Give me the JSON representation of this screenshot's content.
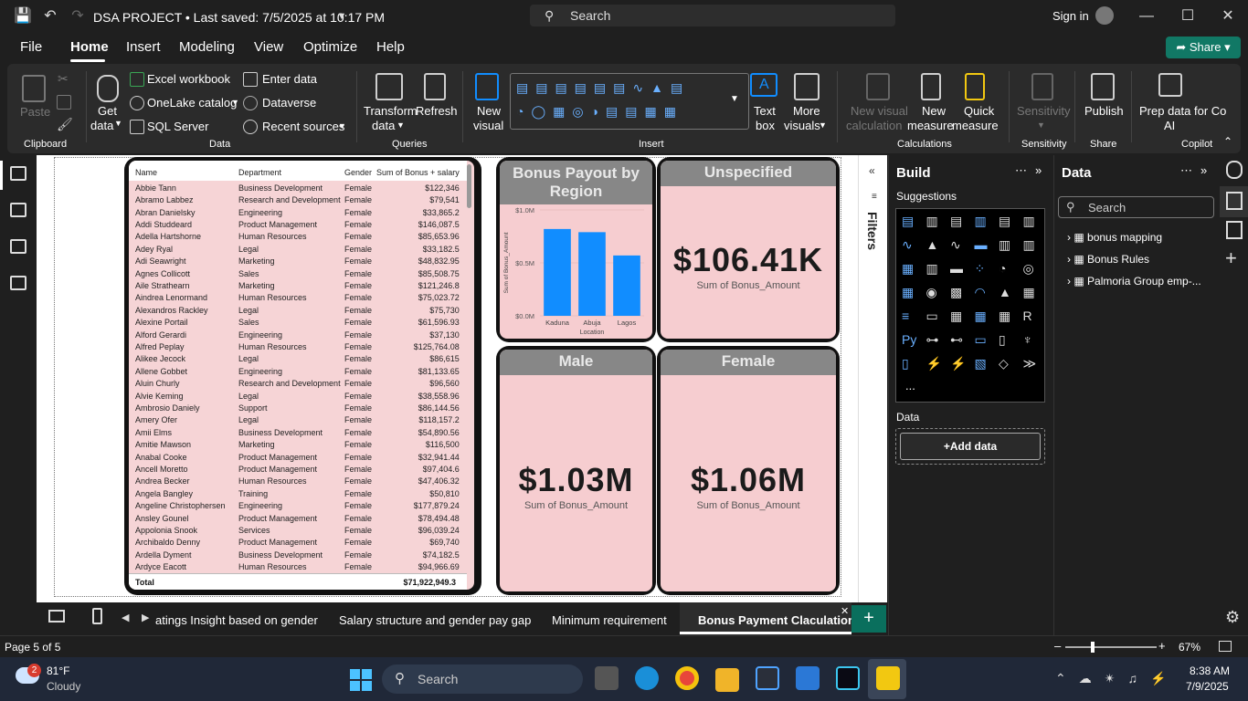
{
  "window": {
    "title": "DSA PROJECT • Last saved: 7/5/2025 at 10:17 PM",
    "search_placeholder": "Search",
    "sign_in": "Sign in"
  },
  "menu": [
    "File",
    "Home",
    "Insert",
    "Modeling",
    "View",
    "Optimize",
    "Help"
  ],
  "share_label": "Share",
  "ribbon": {
    "paste": "Paste",
    "clipboard": "Clipboard",
    "get_data_1": "Get",
    "get_data_2": "data",
    "excel_workbook": "Excel workbook",
    "onelake_catalog": "OneLake catalog",
    "sql_server": "SQL Server",
    "enter_data": "Enter data",
    "dataverse": "Dataverse",
    "recent_sources": "Recent sources",
    "data_group": "Data",
    "transform_1": "Transform",
    "transform_2": "data",
    "refresh": "Refresh",
    "queries_group": "Queries",
    "new_visual_1": "New",
    "new_visual_2": "visual",
    "insert_group": "Insert",
    "text_box_1": "Text",
    "text_box_2": "box",
    "more_visuals_1": "More",
    "more_visuals_2": "visuals",
    "new_visual_calc_1": "New visual",
    "new_visual_calc_2": "calculation",
    "new_measure_1": "New",
    "new_measure_2": "measure",
    "quick_measure_1": "Quick",
    "quick_measure_2": "measure",
    "calculations_group": "Calculations",
    "sensitivity": "Sensitivity",
    "sensitivity_group": "Sensitivity",
    "publish": "Publish",
    "share_group": "Share",
    "prep_ai_1": "Prep data for Co",
    "prep_ai_2": "AI",
    "copilot_group": "Copilot"
  },
  "table_visual": {
    "headers": [
      "Name",
      "Department",
      "Gender",
      "Sum of Bonus + salary"
    ],
    "rows": [
      [
        "Abbie Tann",
        "Business Development",
        "Female",
        "$122,346"
      ],
      [
        "Abramo Labbez",
        "Research and Development",
        "Female",
        "$79,541"
      ],
      [
        "Abran Danielsky",
        "Engineering",
        "Female",
        "$33,865.2"
      ],
      [
        "Addi Studdeard",
        "Product Management",
        "Female",
        "$146,087.5"
      ],
      [
        "Adella Hartshorne",
        "Human Resources",
        "Female",
        "$85,653.96"
      ],
      [
        "Adey Ryal",
        "Legal",
        "Female",
        "$33,182.5"
      ],
      [
        "Adi Seawright",
        "Marketing",
        "Female",
        "$48,832.95"
      ],
      [
        "Agnes Collicott",
        "Sales",
        "Female",
        "$85,508.75"
      ],
      [
        "Aile Strathearn",
        "Marketing",
        "Female",
        "$121,246.8"
      ],
      [
        "Aindrea Lenormand",
        "Human Resources",
        "Female",
        "$75,023.72"
      ],
      [
        "Alexandros Rackley",
        "Legal",
        "Female",
        "$75,730"
      ],
      [
        "Alexine Portail",
        "Sales",
        "Female",
        "$61,596.93"
      ],
      [
        "Alford Gerardi",
        "Engineering",
        "Female",
        "$37,130"
      ],
      [
        "Alfred Peplay",
        "Human Resources",
        "Female",
        "$125,764.08"
      ],
      [
        "Alikee Jecock",
        "Legal",
        "Female",
        "$86,615"
      ],
      [
        "Allene Gobbet",
        "Engineering",
        "Female",
        "$81,133.65"
      ],
      [
        "Aluin Churly",
        "Research and Development",
        "Female",
        "$96,560"
      ],
      [
        "Alvie Keming",
        "Legal",
        "Female",
        "$38,558.96"
      ],
      [
        "Ambrosio Daniely",
        "Support",
        "Female",
        "$86,144.56"
      ],
      [
        "Amery Ofer",
        "Legal",
        "Female",
        "$118,157.2"
      ],
      [
        "Amii Elms",
        "Business Development",
        "Female",
        "$54,890.56"
      ],
      [
        "Amitie Mawson",
        "Marketing",
        "Female",
        "$116,500"
      ],
      [
        "Anabal Cooke",
        "Product Management",
        "Female",
        "$32,941.44"
      ],
      [
        "Ancell Moretto",
        "Product Management",
        "Female",
        "$97,404.6"
      ],
      [
        "Andrea Becker",
        "Human Resources",
        "Female",
        "$47,406.32"
      ],
      [
        "Angela Bangley",
        "Training",
        "Female",
        "$50,810"
      ],
      [
        "Angeline Christophersen",
        "Engineering",
        "Female",
        "$177,879.24"
      ],
      [
        "Ansley Gounel",
        "Product Management",
        "Female",
        "$78,494.48"
      ],
      [
        "Appolonia Snook",
        "Services",
        "Female",
        "$96,039.24"
      ],
      [
        "Archibaldo Denny",
        "Product Management",
        "Female",
        "$69,740"
      ],
      [
        "Ardella Dyment",
        "Business Development",
        "Female",
        "$74,182.5"
      ],
      [
        "Ardyce Eacott",
        "Human Resources",
        "Female",
        "$94,966.69"
      ]
    ],
    "total_label": "Total",
    "total_value": "$71,922,949.3"
  },
  "chart_card": {
    "title": "Bonus Payout by Region"
  },
  "chart_data": {
    "type": "bar",
    "title": "Bonus Payout by Region",
    "categories": [
      "Kaduna",
      "Abuja",
      "Lagos"
    ],
    "values": [
      0.82,
      0.79,
      0.57
    ],
    "xlabel": "Location",
    "ylabel": "Sum of Bonus_Amount",
    "ylim": [
      0,
      1.0
    ],
    "y_tick_labels": [
      "$0.0M",
      "$0.5M",
      "$1.0M"
    ],
    "color": "#118dff"
  },
  "cards": {
    "unspecified": {
      "title": "Unspecified",
      "value": "$106.41K",
      "sub": "Sum of Bonus_Amount"
    },
    "male": {
      "title": "Male",
      "value": "$1.03M",
      "sub": "Sum of Bonus_Amount"
    },
    "female": {
      "title": "Female",
      "value": "$1.06M",
      "sub": "Sum of Bonus_Amount"
    }
  },
  "filters_label": "Filters",
  "build_pane": {
    "title": "Build",
    "suggestions": "Suggestions",
    "data_label": "Data",
    "add_data": "+Add data",
    "more": "..."
  },
  "data_pane": {
    "title": "Data",
    "search_placeholder": "Search",
    "tables": [
      "bonus mapping",
      "Bonus Rules",
      "Palmoria Group emp-..."
    ]
  },
  "tabs": {
    "items": [
      "atings Insight based on gender",
      "Salary structure and gender pay gap",
      "Minimum requirement",
      "Bonus Payment Claculation"
    ],
    "active_index": 3,
    "add": "+"
  },
  "status": {
    "page": "Page 5 of 5",
    "zoom": "67%",
    "zoom_fraction": 0.67
  },
  "taskbar": {
    "weather_temp": "81°F",
    "weather_desc": "Cloudy",
    "weather_badge": "2",
    "search_placeholder": "Search",
    "time": "8:38 AM",
    "date": "7/9/2025"
  }
}
